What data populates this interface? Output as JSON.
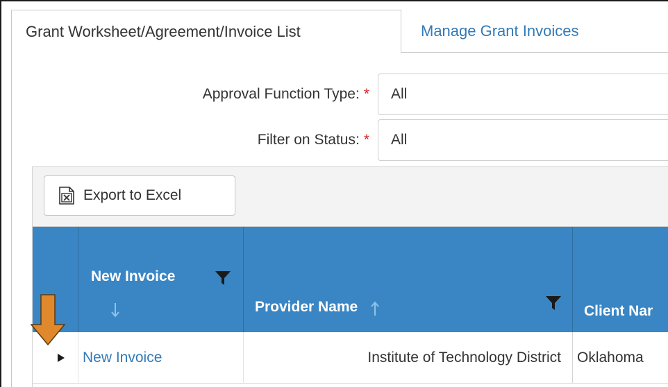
{
  "tabs": [
    {
      "label": "Grant Worksheet/Agreement/Invoice List",
      "active": true
    },
    {
      "label": "Manage Grant Invoices",
      "active": false
    }
  ],
  "filters": {
    "approval_type": {
      "label": "Approval Function Type:",
      "required": "*",
      "value": "All"
    },
    "status": {
      "label": "Filter on Status:",
      "required": "*",
      "value": "All"
    }
  },
  "toolbar": {
    "export_label": "Export to Excel",
    "export_icon": "excel-file-icon"
  },
  "grid": {
    "columns": [
      {
        "label": "New Invoice",
        "sort": "descending",
        "filter": true
      },
      {
        "label": "Provider Name",
        "sort": "ascending",
        "filter": true
      },
      {
        "label": "Client Nar",
        "sort": null,
        "filter": false
      }
    ],
    "rows": [
      {
        "new_invoice": "New Invoice",
        "provider_name": "Institute of Technology District",
        "client_name": "Oklahoma"
      }
    ]
  },
  "colors": {
    "header_bg": "#3a86c4",
    "link": "#337ab7",
    "required": "#d9232e",
    "annotation_arrow": "#e0892c"
  }
}
